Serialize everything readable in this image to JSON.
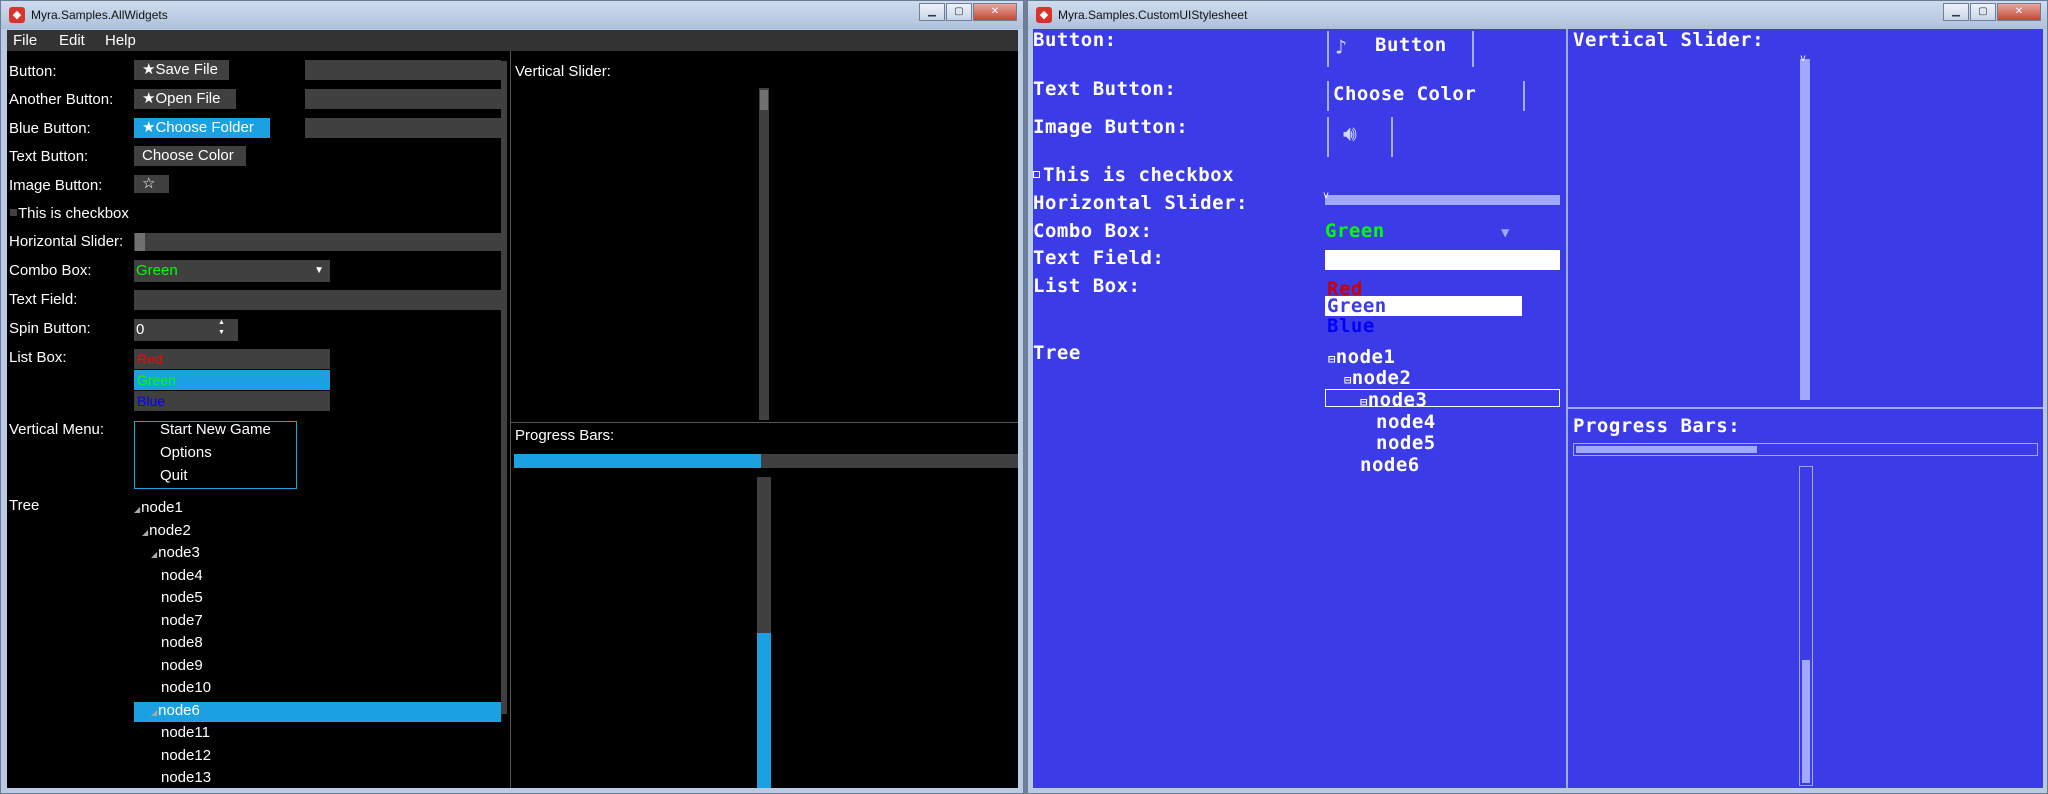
{
  "window1": {
    "title": "Myra.Samples.AllWidgets",
    "menu": [
      "File",
      "Edit",
      "Help"
    ],
    "labels": {
      "button": "Button:",
      "another_button": "Another Button:",
      "blue_button": "Blue Button:",
      "text_button": "Text Button:",
      "image_button": "Image Button:",
      "checkbox": "This is checkbox",
      "horizontal_slider": "Horizontal Slider:",
      "combo_box": "Combo Box:",
      "text_field": "Text Field:",
      "spin_button": "Spin Button:",
      "list_box": "List Box:",
      "vertical_menu": "Vertical Menu:",
      "tree": "Tree",
      "vertical_slider": "Vertical Slider:",
      "progress_bars": "Progress Bars:"
    },
    "buttons": {
      "save_file": "Save File",
      "open_file": "Open File",
      "choose_folder": "Choose Folder",
      "choose_color": "Choose Color",
      "star_icon": "★",
      "image_star": "☆"
    },
    "combo_value": "Green",
    "spin_value": "0",
    "list_items": [
      {
        "label": "Red",
        "color": "#ff0000"
      },
      {
        "label": "Green",
        "color": "#00ff00",
        "selected": true
      },
      {
        "label": "Blue",
        "color": "#0000ff"
      }
    ],
    "menu_items": [
      "Start New Game",
      "Options",
      "Quit"
    ],
    "tree_nodes": [
      "node1",
      "node2",
      "node3",
      "node4",
      "node5",
      "node7",
      "node8",
      "node9",
      "node10",
      "node6",
      "node11",
      "node12",
      "node13"
    ],
    "selected_tree_node": "node6",
    "horizontal_progress": 0.49,
    "vertical_progress": 0.5,
    "accent": "#1ba1e2"
  },
  "window2": {
    "title": "Myra.Samples.CustomUIStylesheet",
    "labels": {
      "button": "Button:",
      "text_button": "Text Button:",
      "image_button": "Image Button:",
      "checkbox": "This is checkbox",
      "horizontal_slider": "Horizontal Slider:",
      "combo_box": "Combo Box:",
      "text_field": "Text Field:",
      "list_box": "List Box:",
      "tree": "Tree",
      "vertical_slider": "Vertical Slider:",
      "progress_bars": "Progress Bars:"
    },
    "button_label": "Button",
    "text_button_label": "Choose Color",
    "combo_value": "Green",
    "list_items": [
      {
        "label": "Red",
        "color": "#cc0000"
      },
      {
        "label": "Green",
        "color": "#3b3be8",
        "selected": true
      },
      {
        "label": "Blue",
        "color": "#0000ff"
      }
    ],
    "tree_nodes": [
      "node1",
      "node2",
      "node3",
      "node4",
      "node5",
      "node6"
    ],
    "horizontal_progress": 0.4,
    "vertical_progress": 0.4,
    "background": "#3b3be8"
  }
}
